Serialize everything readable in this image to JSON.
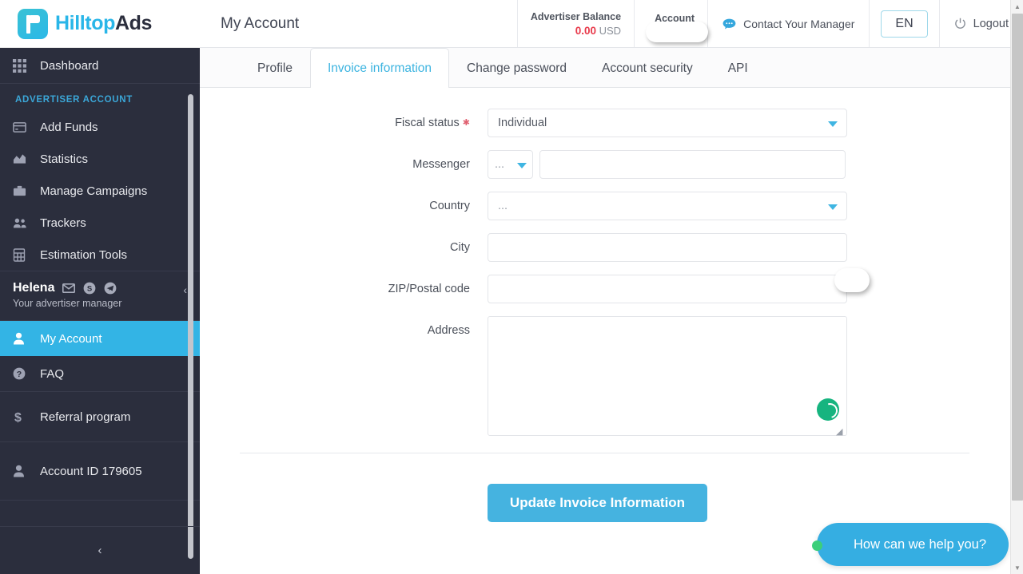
{
  "brand": {
    "name_part1": "Hilltop",
    "name_part2": "Ads",
    "logo_icon": "flag-logo-icon",
    "accent_color": "#29b6e8",
    "sidebar_color": "#2b2e3d"
  },
  "header": {
    "page_title": "My Account",
    "balance": {
      "label": "Advertiser Balance",
      "amount": "0.00",
      "currency": "USD",
      "amount_color": "#e8394a"
    },
    "account_id": {
      "label": "Account ID",
      "value": ""
    },
    "contact_manager": {
      "label": "Contact Your Manager",
      "icon": "chat-bubble-icon"
    },
    "language": {
      "label": "EN"
    },
    "logout": {
      "label": "Logout",
      "icon": "power-icon"
    }
  },
  "sidebar": {
    "dashboard": {
      "label": "Dashboard",
      "icon": "grid-icon"
    },
    "section_title": "ADVERTISER ACCOUNT",
    "items": [
      {
        "label": "Add Funds",
        "icon": "credit-card-icon"
      },
      {
        "label": "Statistics",
        "icon": "chart-area-icon"
      },
      {
        "label": "Manage Campaigns",
        "icon": "briefcase-icon"
      },
      {
        "label": "Trackers",
        "icon": "users-icon"
      },
      {
        "label": "Estimation Tools",
        "icon": "calculator-icon"
      }
    ],
    "manager": {
      "name": "Helena",
      "subtitle": "Your advertiser manager",
      "icons": [
        "envelope-icon",
        "skype-icon",
        "telegram-icon"
      ],
      "collapse_icon": "chevron-left-icon"
    },
    "account_items": [
      {
        "label": "My Account",
        "icon": "user-icon",
        "active": true
      },
      {
        "label": "FAQ",
        "icon": "question-circle-icon",
        "active": false
      }
    ],
    "referral": {
      "label": "Referral program",
      "icon": "dollar-icon"
    },
    "account_id_item": {
      "label": "Account ID 179605",
      "icon": "user-icon"
    },
    "collapse": {
      "icon": "chevron-left-icon"
    }
  },
  "tabs": [
    {
      "label": "Profile",
      "active": false
    },
    {
      "label": "Invoice information",
      "active": true
    },
    {
      "label": "Change password",
      "active": false
    },
    {
      "label": "Account security",
      "active": false
    },
    {
      "label": "API",
      "active": false
    }
  ],
  "form": {
    "fiscal_status": {
      "label": "Fiscal status",
      "required": true,
      "value": "Individual"
    },
    "messenger": {
      "label": "Messenger",
      "type_value": "...",
      "value": "",
      "placeholder": ""
    },
    "country": {
      "label": "Country",
      "value": "..."
    },
    "city": {
      "label": "City",
      "value": "",
      "placeholder": ""
    },
    "zip": {
      "label": "ZIP/Postal code",
      "value": "",
      "placeholder": ""
    },
    "address": {
      "label": "Address",
      "value": "",
      "placeholder": ""
    },
    "submit": {
      "label": "Update Invoice Information"
    },
    "spinner": {
      "icon": "loading-spinner-icon",
      "color": "#16b47f"
    }
  },
  "chat_widget": {
    "text": "How can we help you?",
    "status_dot_color": "#3ccf7a",
    "background_color": "#35aee2"
  }
}
